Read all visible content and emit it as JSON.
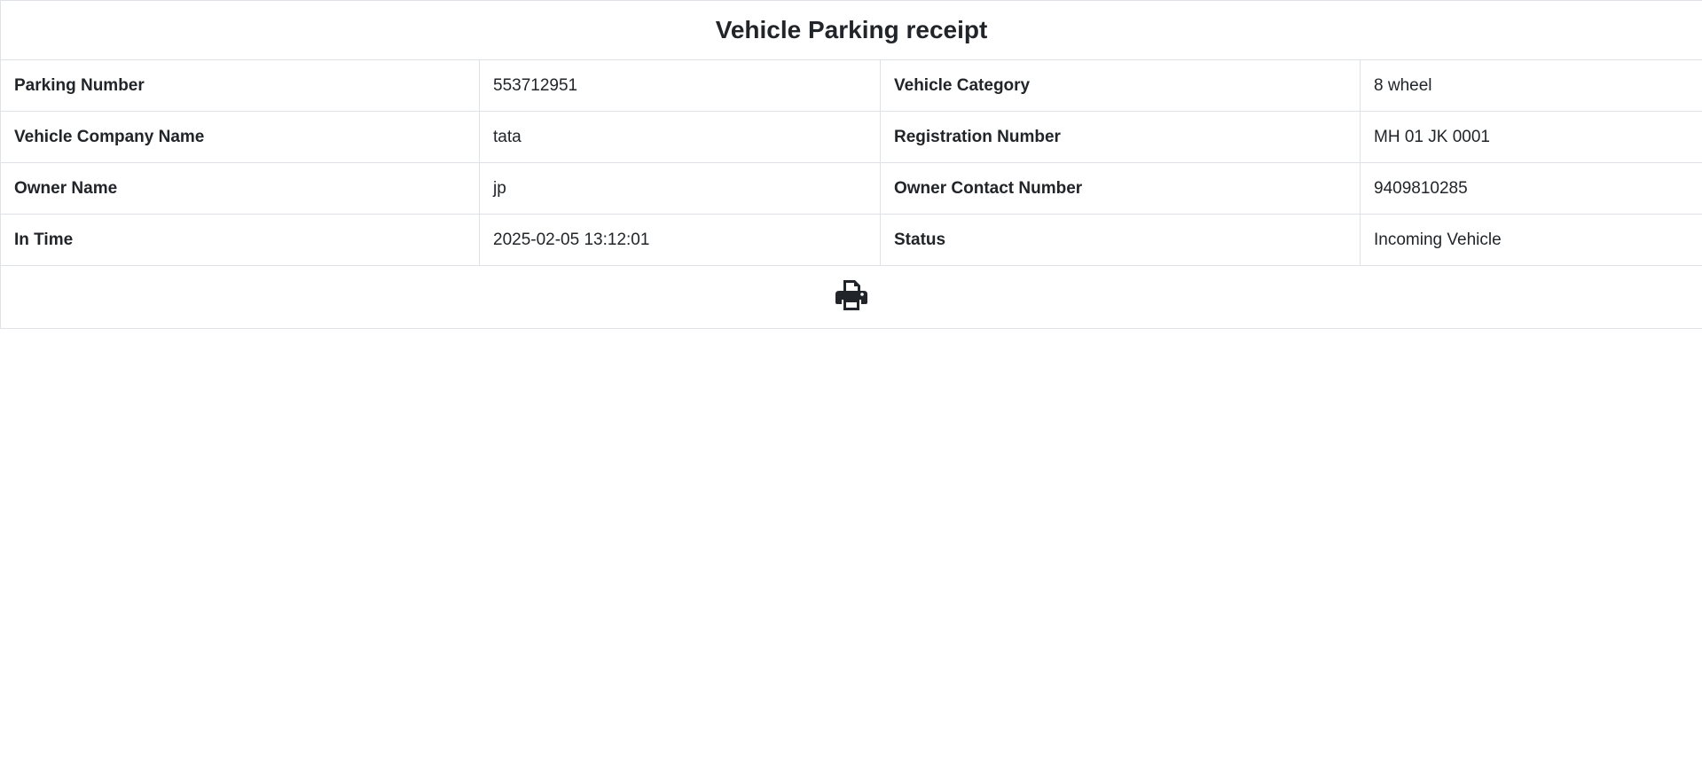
{
  "receipt": {
    "title": "Vehicle Parking receipt",
    "rows": [
      {
        "label1": "Parking Number",
        "value1": "553712951",
        "label2": "Vehicle Category",
        "value2": "8 wheel"
      },
      {
        "label1": "Vehicle Company Name",
        "value1": "tata",
        "label2": "Registration Number",
        "value2": "MH 01 JK 0001"
      },
      {
        "label1": "Owner Name",
        "value1": "jp",
        "label2": "Owner Contact Number",
        "value2": "9409810285"
      },
      {
        "label1": "In Time",
        "value1": "2025-02-05 13:12:01",
        "label2": "Status",
        "value2": "Incoming Vehicle"
      }
    ],
    "print_icon": "print-icon"
  },
  "colors": {
    "text": "#212529",
    "border": "#dee2e6",
    "background": "#ffffff"
  }
}
